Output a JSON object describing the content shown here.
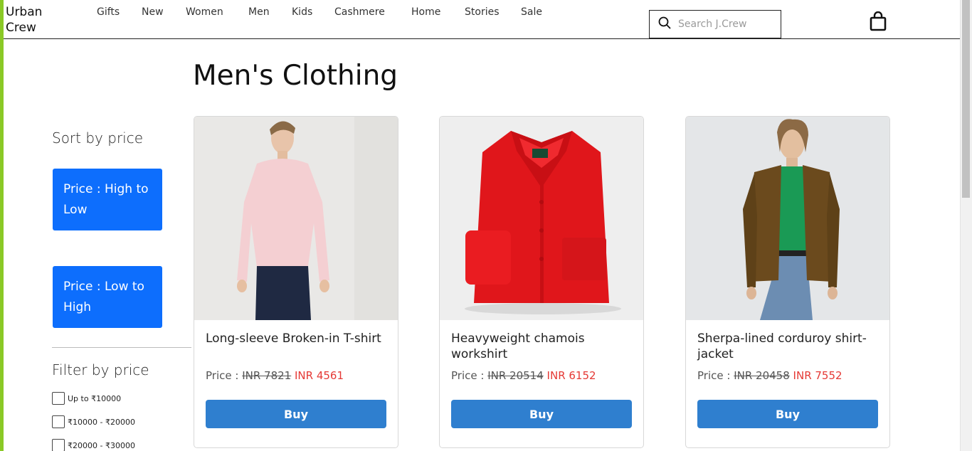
{
  "brand": {
    "line1": "Urban",
    "line2": "Crew"
  },
  "nav": [
    "Gifts",
    "New",
    "Women",
    "Men",
    "Kids",
    "Cashmere",
    "Home",
    "Stories",
    "Sale"
  ],
  "search": {
    "placeholder": "Search J.Crew"
  },
  "page_title": "Men's Clothing",
  "sort": {
    "heading": "Sort by price",
    "high_to_low": "Price : High to Low",
    "low_to_high": "Price : Low to High"
  },
  "filter": {
    "heading": "Filter by price",
    "options": [
      "Up to ₹10000",
      "₹10000 - ₹20000",
      "₹20000 - ₹30000"
    ]
  },
  "products": [
    {
      "name": "Long-sleeve Broken-in T-shirt",
      "price_label": "Price :",
      "old_price": "INR 7821",
      "new_price": "INR 4561",
      "buy": "Buy"
    },
    {
      "name": "Heavyweight chamois workshirt",
      "price_label": "Price :",
      "old_price": "INR 20514",
      "new_price": "INR 6152",
      "buy": "Buy"
    },
    {
      "name": "Sherpa-lined corduroy shirt-jacket",
      "price_label": "Price :",
      "old_price": "INR 20458",
      "new_price": "INR 7552",
      "buy": "Buy"
    }
  ],
  "colors": {
    "accent": "#0d6efd",
    "buy_button": "#2f7fcf",
    "sale_price": "#e53935",
    "window_accent": "#8ac926"
  }
}
